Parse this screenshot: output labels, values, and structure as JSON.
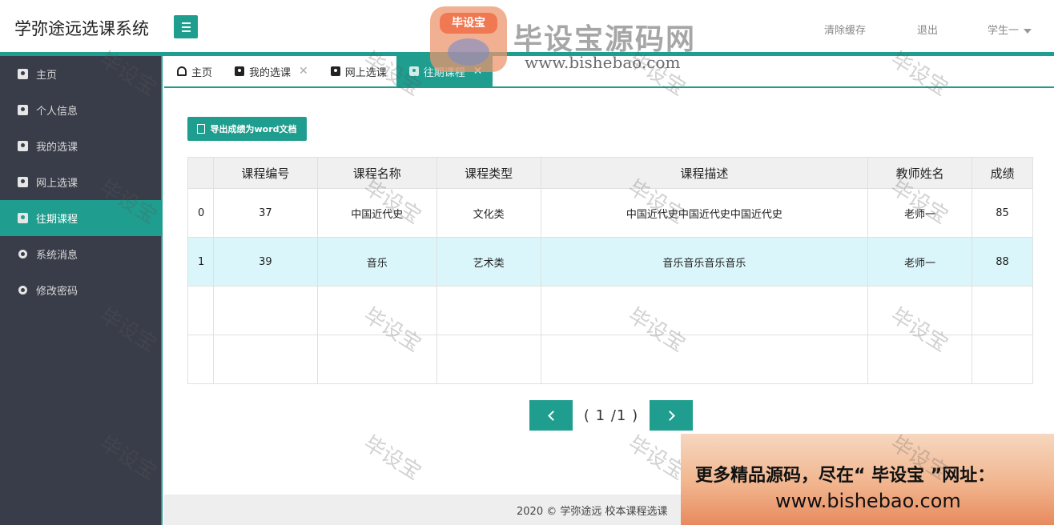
{
  "header": {
    "app_title": "学弥途远选课系统",
    "clear_cache": "清除缓存",
    "logout": "退出",
    "user_name": "学生一"
  },
  "sidebar": {
    "items": [
      {
        "label": "主页",
        "icon": "book-icon"
      },
      {
        "label": "个人信息",
        "icon": "book-icon"
      },
      {
        "label": "我的选课",
        "icon": "book-icon"
      },
      {
        "label": "网上选课",
        "icon": "book-icon"
      },
      {
        "label": "往期课程",
        "icon": "book-icon",
        "active": true
      },
      {
        "label": "系统消息",
        "icon": "circle-icon"
      },
      {
        "label": "修改密码",
        "icon": "circle-icon"
      }
    ]
  },
  "tabs": [
    {
      "label": "主页",
      "icon": "dashboard-icon",
      "closable": false
    },
    {
      "label": "我的选课",
      "icon": "book-icon",
      "closable": true
    },
    {
      "label": "网上选课",
      "icon": "book-icon",
      "closable": false
    },
    {
      "label": "往期课程",
      "icon": "book-icon",
      "closable": true,
      "active": true
    }
  ],
  "main": {
    "export_label": "导出成绩为word文档",
    "table": {
      "headers": [
        "",
        "课程编号",
        "课程名称",
        "课程类型",
        "课程描述",
        "教师姓名",
        "成绩"
      ],
      "rows": [
        [
          "0",
          "37",
          "中国近代史",
          "文化类",
          "中国近代史中国近代史中国近代史",
          "老师一",
          "85"
        ],
        [
          "1",
          "39",
          "音乐",
          "艺术类",
          "音乐音乐音乐音乐",
          "老师一",
          "88"
        ]
      ]
    },
    "pager": {
      "current": "1",
      "total": "1",
      "text": "( 1 /1 )"
    }
  },
  "footer": {
    "text": "2020 ©  学弥途远  校本课程选课"
  },
  "watermark": {
    "text": "毕设宝",
    "logo_badge": "毕设宝",
    "logo_name": "毕设宝源码网",
    "logo_url": "www.bishebao.com",
    "promo_line1": "更多精品源码，尽在“ 毕设宝 ”网址：",
    "promo_line2": "www.bishebao.com"
  },
  "colors": {
    "accent": "#1f9d8e",
    "sidebar_bg": "#393d49",
    "highlight_row": "#dbf6fa"
  }
}
